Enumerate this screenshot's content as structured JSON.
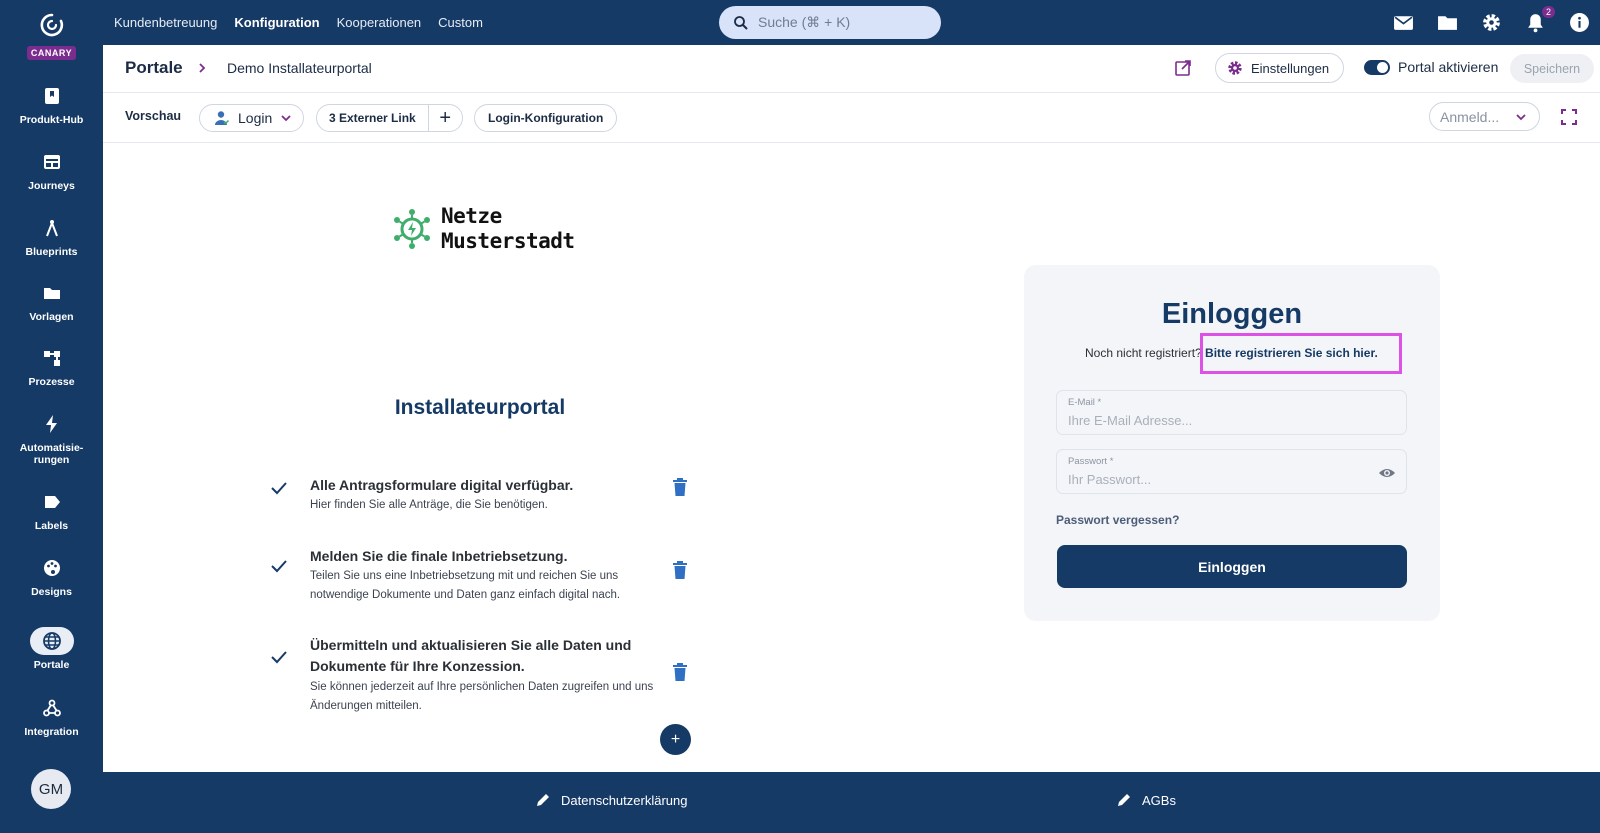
{
  "colors": {
    "navy": "#163a66",
    "brand_purple": "#7a2d8f",
    "highlight": "#dd52e6",
    "logo_green": "#3fae6b"
  },
  "brand": {
    "badge": "CANARY",
    "icon": "canary-logo-icon"
  },
  "sidebar": {
    "items": [
      {
        "label": "Produkt-Hub",
        "icon": "bookmark-icon"
      },
      {
        "label": "Journeys",
        "icon": "journeys-icon"
      },
      {
        "label": "Blueprints",
        "icon": "compass-icon"
      },
      {
        "label": "Vorlagen",
        "icon": "folder-icon"
      },
      {
        "label": "Prozesse",
        "icon": "process-icon"
      },
      {
        "label": "Automatisie-",
        "label2": "rungen",
        "icon": "bolt-icon"
      },
      {
        "label": "Labels",
        "icon": "label-icon"
      },
      {
        "label": "Designs",
        "icon": "palette-icon"
      },
      {
        "label": "Portale",
        "icon": "globe-icon",
        "active": true
      },
      {
        "label": "Integration",
        "icon": "webhook-icon"
      }
    ],
    "avatar": "GM"
  },
  "topnav": {
    "items": [
      "Kundenbetreuung",
      "Konfiguration",
      "Kooperationen",
      "Custom"
    ],
    "active": "Konfiguration"
  },
  "search": {
    "placeholder": "Suche (⌘ + K)"
  },
  "notifications": {
    "count": "2"
  },
  "header": {
    "root": "Portale",
    "page": "Demo Installateurportal",
    "settings_label": "Einstellungen",
    "toggle_label": "Portal aktivieren",
    "save_label": "Speichern"
  },
  "toolbar": {
    "preview_label": "Vorschau",
    "login_label": "Login",
    "external_label": "3 Externer Link",
    "plus": "+",
    "config_label": "Login-Konfiguration",
    "lang_value": "Anmeld..."
  },
  "preview": {
    "logo_line1": "Netze",
    "logo_line2": "Musterstadt",
    "title": "Installateurportal",
    "features": [
      {
        "title": "Alle Antragsformulare digital verfügbar.",
        "desc": "Hier finden Sie alle Anträge, die Sie benötigen."
      },
      {
        "title": "Melden Sie die finale Inbetriebsetzung.",
        "desc": "Teilen Sie uns eine Inbetriebsetzung mit und reichen Sie uns notwendige Dokumente und Daten ganz einfach digital nach."
      },
      {
        "title": "Übermitteln und aktualisieren Sie alle Daten und Dokumente für Ihre Konzession.",
        "desc": "Sie können jederzeit auf Ihre persönlichen Daten zugreifen und uns Änderungen mitteilen."
      }
    ],
    "add": "+"
  },
  "login": {
    "title": "Einloggen",
    "register_prefix": "Noch nicht registriert? ",
    "register_link": "Bitte registrieren Sie sich hier.",
    "email_label": "E-Mail *",
    "email_placeholder": "Ihre E-Mail Adresse...",
    "password_label": "Passwort *",
    "password_placeholder": "Ihr Passwort...",
    "forgot": "Passwort vergessen?",
    "submit": "Einloggen"
  },
  "footer": {
    "privacy": "Datenschutzerklärung",
    "terms": "AGBs"
  }
}
